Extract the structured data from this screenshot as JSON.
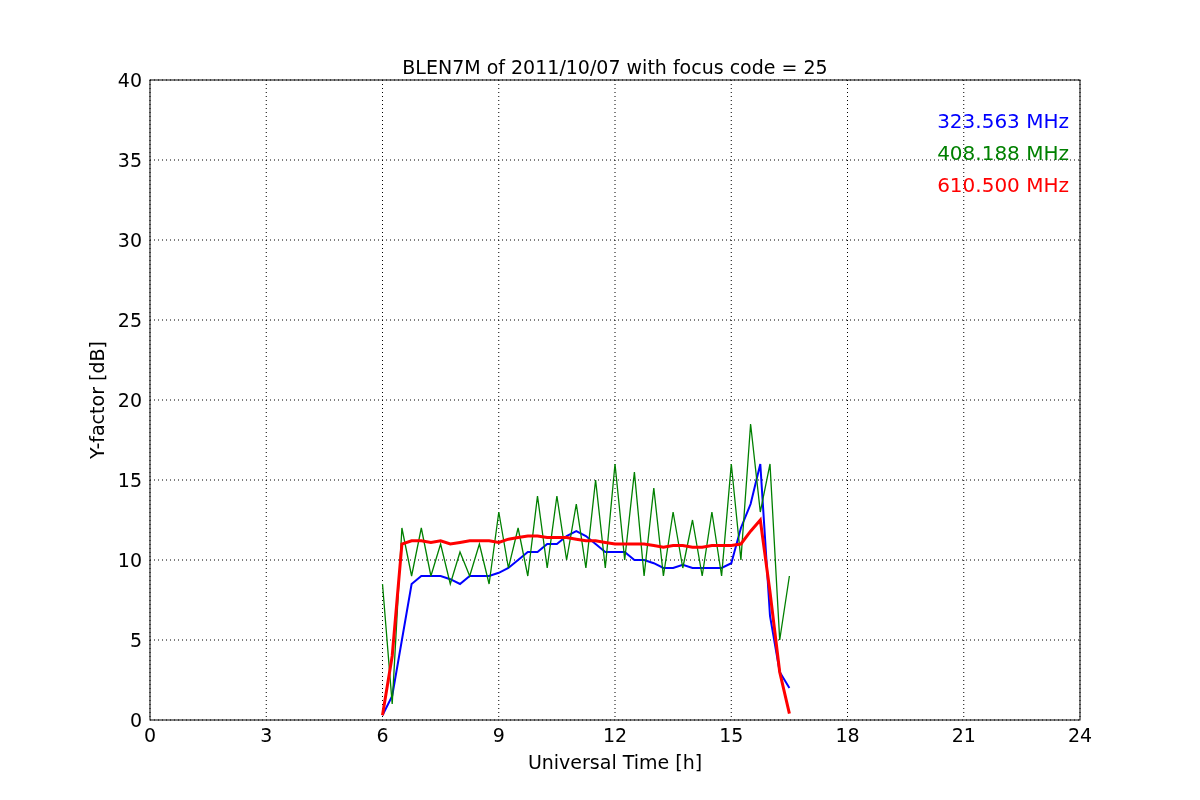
{
  "chart_data": {
    "type": "line",
    "title": "BLEN7M of 2011/10/07 with focus code = 25",
    "xlabel": "Universal Time [h]",
    "ylabel": "Y-factor [dB]",
    "x": [
      6,
      6.25,
      6.5,
      6.75,
      7,
      7.25,
      7.5,
      7.75,
      8,
      8.25,
      8.5,
      8.75,
      9,
      9.25,
      9.5,
      9.75,
      10,
      10.25,
      10.5,
      10.75,
      11,
      11.25,
      11.5,
      11.75,
      12,
      12.25,
      12.5,
      12.75,
      13,
      13.25,
      13.5,
      13.75,
      14,
      14.25,
      14.5,
      14.75,
      15,
      15.25,
      15.5,
      15.75,
      16,
      16.25,
      16.5
    ],
    "series": [
      {
        "name": "323.563 MHz",
        "color": "#0000ff",
        "values": [
          0.3,
          1.5,
          5,
          8.5,
          9,
          9,
          9,
          8.8,
          8.5,
          9,
          9,
          9,
          9.2,
          9.5,
          10,
          10.5,
          10.5,
          11,
          11,
          11.5,
          11.8,
          11.5,
          11,
          10.5,
          10.5,
          10.5,
          10,
          10,
          9.8,
          9.5,
          9.5,
          9.7,
          9.5,
          9.5,
          9.5,
          9.5,
          9.8,
          12,
          13.5,
          16,
          6.5,
          3,
          2
        ]
      },
      {
        "name": "408.188 MHz",
        "color": "#008000",
        "values": [
          8.5,
          1,
          12,
          9,
          12,
          9,
          11,
          8.5,
          10.5,
          9,
          11,
          8.5,
          13,
          9.5,
          12,
          9,
          14,
          9.5,
          14,
          10,
          13.5,
          9.5,
          15,
          9.5,
          16,
          10,
          15.5,
          9,
          14.5,
          9,
          13,
          9.5,
          12.5,
          9,
          13,
          9,
          16,
          10,
          18.5,
          13,
          16,
          5,
          9
        ]
      },
      {
        "name": "610.500 MHz",
        "color": "#ff0000",
        "values": [
          0.3,
          4,
          11,
          11.2,
          11.2,
          11.1,
          11.2,
          11,
          11.1,
          11.2,
          11.2,
          11.2,
          11.1,
          11.3,
          11.4,
          11.5,
          11.5,
          11.4,
          11.4,
          11.4,
          11.3,
          11.2,
          11.2,
          11.1,
          11,
          11,
          11,
          11,
          10.9,
          10.8,
          10.9,
          10.9,
          10.8,
          10.8,
          10.9,
          10.9,
          10.9,
          11,
          11.8,
          12.5,
          8,
          3,
          0.4
        ]
      }
    ],
    "grid": true,
    "xlim": [
      0,
      24
    ],
    "ylim": [
      0,
      40
    ],
    "xticks": [
      0,
      3,
      6,
      9,
      12,
      15,
      18,
      21,
      24
    ],
    "yticks": [
      0,
      5,
      10,
      15,
      20,
      25,
      30,
      35,
      40
    ]
  }
}
